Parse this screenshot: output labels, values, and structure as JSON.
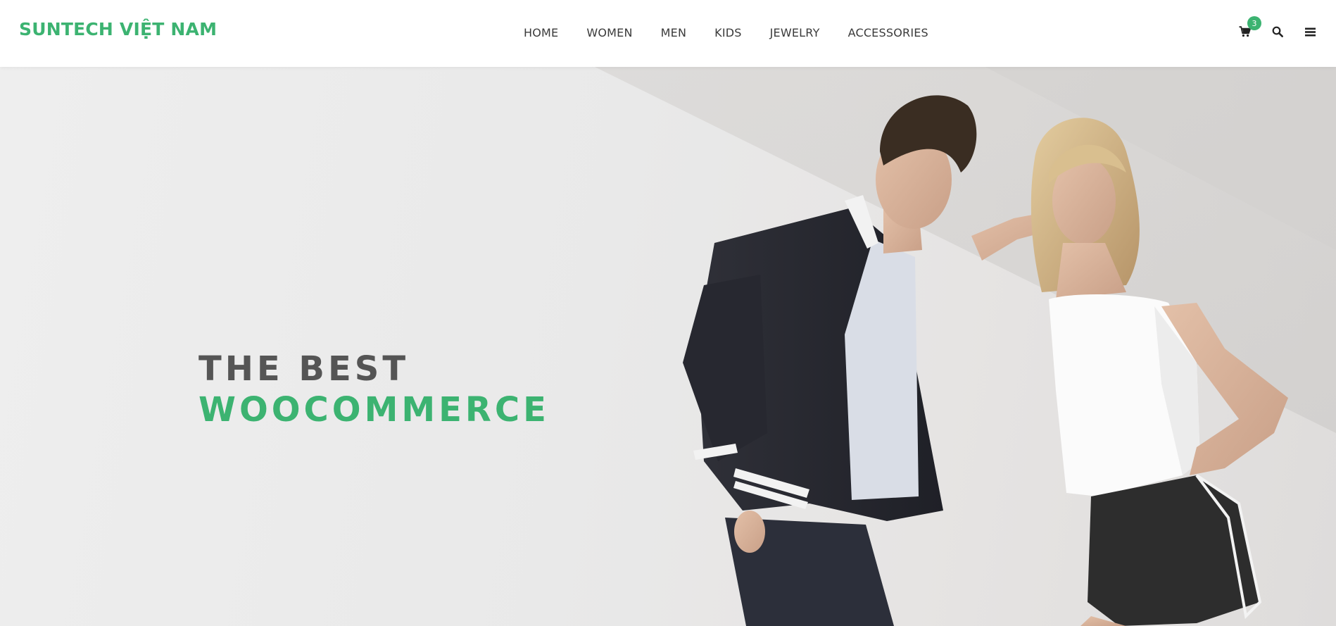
{
  "brand": {
    "name": "SUNTECH VIỆT NAM",
    "accent_color": "#3cb371"
  },
  "nav": {
    "items": [
      {
        "label": "HOME"
      },
      {
        "label": "WOMEN"
      },
      {
        "label": "MEN"
      },
      {
        "label": "KIDS"
      },
      {
        "label": "JEWELRY"
      },
      {
        "label": "ACCESSORIES"
      }
    ]
  },
  "tools": {
    "cart_icon": "shopping-cart-icon",
    "cart_count": "3",
    "search_icon": "search-icon",
    "menu_icon": "hamburger-menu-icon"
  },
  "hero": {
    "line1": "THE BEST",
    "line2": "WOOCOMMERCE",
    "line1_color": "#555555",
    "line2_color": "#3cb371"
  }
}
